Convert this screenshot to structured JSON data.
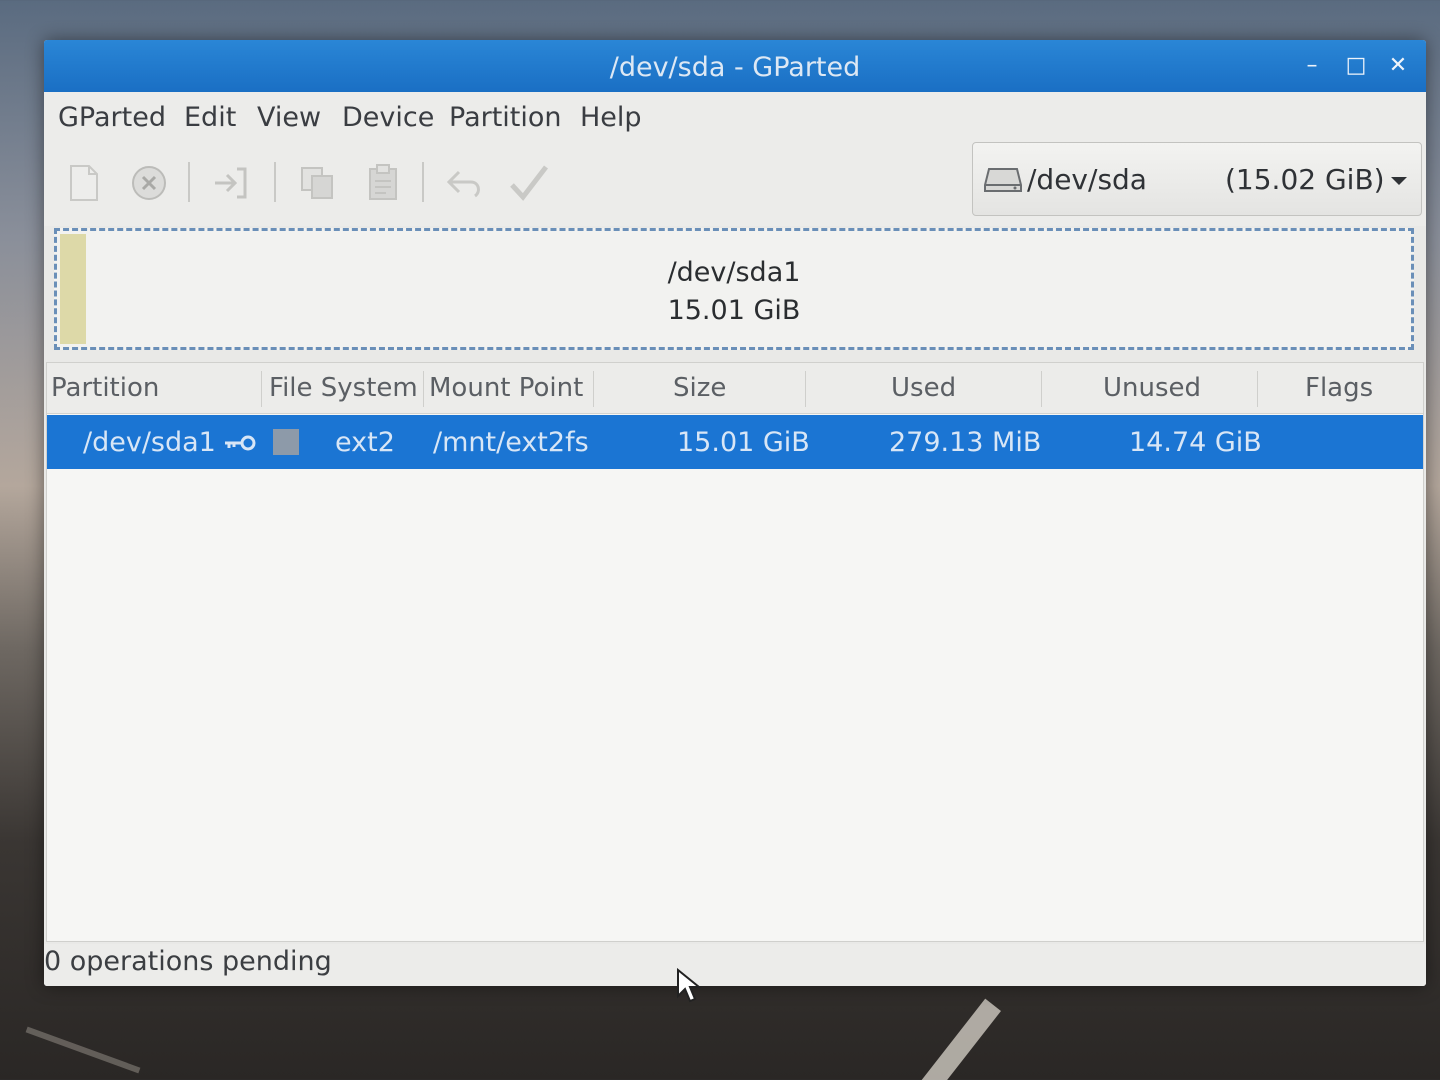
{
  "window": {
    "title": "/dev/sda - GParted",
    "minimize_glyph": "–",
    "maximize_glyph": "□",
    "close_glyph": "✕"
  },
  "menu": {
    "items": [
      "GParted",
      "Edit",
      "View",
      "Device",
      "Partition",
      "Help"
    ]
  },
  "toolbar": {
    "icons": [
      "new-partition-icon",
      "delete-icon",
      "resize-move-icon",
      "copy-icon",
      "paste-icon",
      "undo-icon",
      "apply-icon"
    ],
    "all_disabled": true
  },
  "device_selector": {
    "name": "/dev/sda",
    "size": "(15.02 GiB)"
  },
  "disk_graph": {
    "partition": "/dev/sda1",
    "size": "15.01 GiB"
  },
  "partition_list": {
    "columns": [
      "Partition",
      "File System",
      "Mount Point",
      "Size",
      "Used",
      "Unused",
      "Flags"
    ],
    "rows": [
      {
        "partition": "/dev/sda1",
        "file_system": "ext2",
        "mount_point": "/mnt/ext2fs",
        "size": "15.01 GiB",
        "used": "279.13 MiB",
        "unused": "14.74 GiB",
        "flags": "",
        "mounted": true,
        "selected": true
      }
    ]
  },
  "status": {
    "text": "0 operations pending"
  },
  "colors": {
    "titlebar": "#1a6fc4",
    "selection": "#1b75d3",
    "ext2_swatch": "#8d9aa9",
    "used_space": "#ddd9a8"
  }
}
